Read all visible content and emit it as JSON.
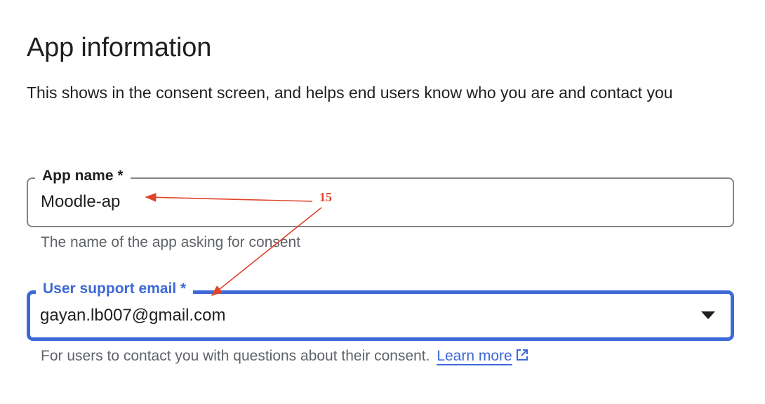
{
  "section": {
    "title": "App information",
    "description": "This shows in the consent screen, and helps end users know who you are and contact you"
  },
  "app_name_field": {
    "label": "App name *",
    "value": "Moodle-ap",
    "helper": "The name of the app asking for consent"
  },
  "support_email_field": {
    "label": "User support email *",
    "value": "gayan.lb007@gmail.com",
    "helper": "For users to contact you with questions about their consent.",
    "learn_more_label": "Learn more",
    "icon": "chevron-down-icon"
  },
  "annotation": {
    "number": "15",
    "color": "#e0442c"
  },
  "colors": {
    "accent": "#3d68d8",
    "border": "#80868b",
    "helper_text": "#5f6368"
  }
}
